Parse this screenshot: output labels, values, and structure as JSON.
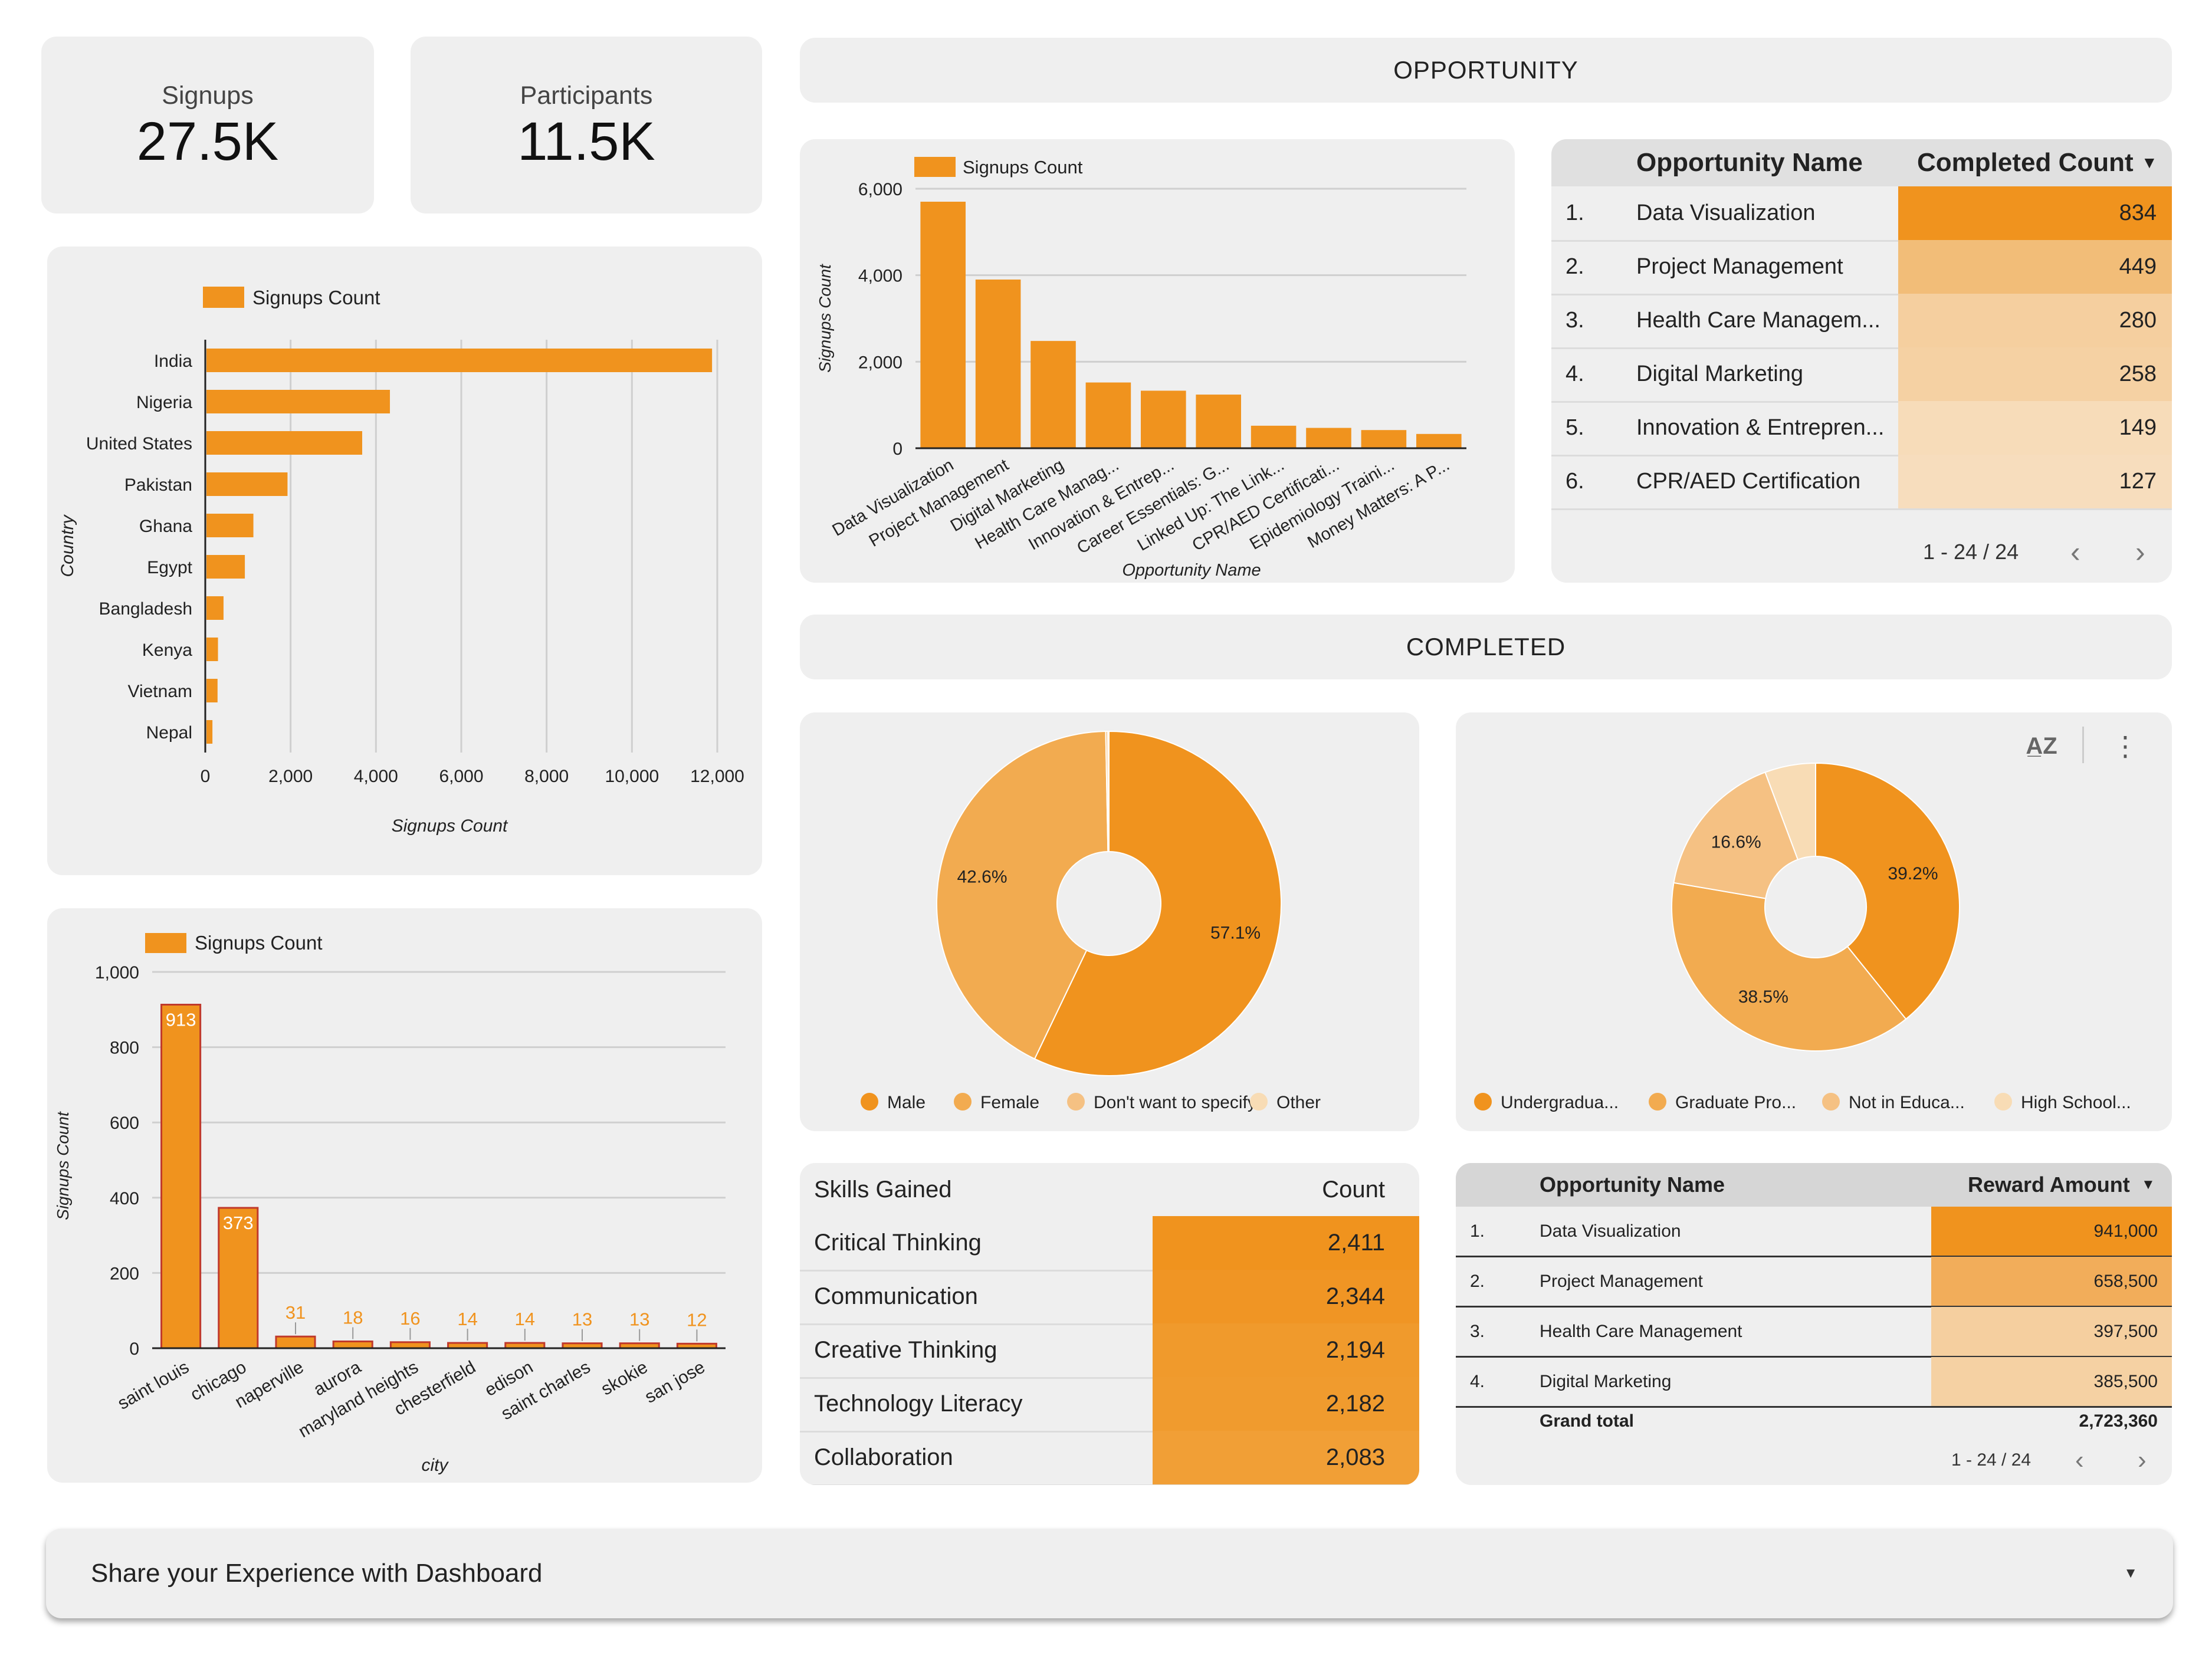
{
  "kpis": {
    "signups": {
      "label": "Signups",
      "value": "27.5K"
    },
    "participants": {
      "label": "Participants",
      "value": "11.5K"
    }
  },
  "sections": {
    "opportunity": "OPPORTUNITY",
    "completed": "COMPLETED"
  },
  "colors": {
    "primary": "#f0931e",
    "light1": "#f2ab50",
    "light2": "#f5c183",
    "light3": "#f8dcb5",
    "bg": "#efefef"
  },
  "chart_data": [
    {
      "id": "country",
      "type": "bar",
      "orientation": "horizontal",
      "legend": "Signups Count",
      "xlabel": "Signups Count",
      "ylabel": "Country",
      "categories": [
        "India",
        "Nigeria",
        "United States",
        "Pakistan",
        "Ghana",
        "Egypt",
        "Bangladesh",
        "Kenya",
        "Vietnam",
        "Nepal"
      ],
      "values": [
        11850,
        4300,
        3650,
        1900,
        1100,
        900,
        400,
        270,
        260,
        140
      ],
      "xlim": [
        0,
        12000
      ],
      "ticks": [
        "0",
        "2,000",
        "4,000",
        "6,000",
        "8,000",
        "10,000",
        "12,000"
      ],
      "color": "#f0931e"
    },
    {
      "id": "city",
      "type": "bar",
      "legend": "Signups Count",
      "xlabel": "city",
      "ylabel": "Signups Count",
      "categories": [
        "saint louis",
        "chicago",
        "naperville",
        "aurora",
        "maryland heights",
        "chesterfield",
        "edison",
        "saint charles",
        "skokie",
        "san jose"
      ],
      "values": [
        913,
        373,
        31,
        18,
        16,
        14,
        14,
        13,
        13,
        12
      ],
      "labels": [
        "913",
        "373",
        "31",
        "18",
        "16",
        "14",
        "14",
        "13",
        "13",
        "12"
      ],
      "ylim": [
        0,
        1000
      ],
      "ticks": [
        "0",
        "200",
        "400",
        "600",
        "800",
        "1,000"
      ],
      "color": "#f0931e"
    },
    {
      "id": "opportunity",
      "type": "bar",
      "legend": "Signups Count",
      "xlabel": "Opportunity Name",
      "ylabel": "Signups Count",
      "categories": [
        "Data Visualization",
        "Project Management",
        "Digital Marketing",
        "Health Care Manag...",
        "Innovation & Entrep...",
        "Career Essentials: G...",
        "Linked Up: The Link...",
        "CPR/AED Certificati...",
        "Epidemiology Traini...",
        "Money Matters: A P..."
      ],
      "values": [
        5700,
        3900,
        2480,
        1520,
        1330,
        1240,
        520,
        470,
        420,
        330
      ],
      "ylim": [
        0,
        6000
      ],
      "ticks": [
        "0",
        "2,000",
        "4,000",
        "6,000"
      ],
      "color": "#f0931e"
    },
    {
      "id": "gender",
      "type": "pie",
      "donut": true,
      "slices": [
        {
          "label": "Male",
          "value": 57.1,
          "text": "57.1%",
          "color": "#f0931e"
        },
        {
          "label": "Female",
          "value": 42.6,
          "text": "42.6%",
          "color": "#f2ab50"
        },
        {
          "label": "Don't want to specify",
          "value": 0.2,
          "text": "",
          "color": "#f5c183"
        },
        {
          "label": "Other",
          "value": 0.1,
          "text": "",
          "color": "#f8dcb5"
        }
      ]
    },
    {
      "id": "education",
      "type": "pie",
      "donut": true,
      "slices": [
        {
          "label": "Undergradua...",
          "value": 39.2,
          "text": "39.2%",
          "color": "#f0931e"
        },
        {
          "label": "Graduate Pro...",
          "value": 38.5,
          "text": "38.5%",
          "color": "#f2ab50"
        },
        {
          "label": "Not in Educa...",
          "value": 16.6,
          "text": "16.6%",
          "color": "#f5c183"
        },
        {
          "label": "High School...",
          "value": 5.7,
          "text": "",
          "color": "#f8dcb5"
        }
      ]
    }
  ],
  "completed_table": {
    "headers": {
      "name": "Opportunity Name",
      "count": "Completed Count"
    },
    "rows": [
      {
        "rank": "1.",
        "name": "Data Visualization",
        "count": "834",
        "n": 834
      },
      {
        "rank": "2.",
        "name": "Project Management",
        "count": "449",
        "n": 449
      },
      {
        "rank": "3.",
        "name": "Health Care Managem...",
        "count": "280",
        "n": 280
      },
      {
        "rank": "4.",
        "name": "Digital Marketing",
        "count": "258",
        "n": 258
      },
      {
        "rank": "5.",
        "name": "Innovation & Entrepren...",
        "count": "149",
        "n": 149
      },
      {
        "rank": "6.",
        "name": "CPR/AED Certification",
        "count": "127",
        "n": 127
      }
    ],
    "pagination": "1 - 24 / 24"
  },
  "skills_table": {
    "headers": {
      "skill": "Skills Gained",
      "count": "Count"
    },
    "rows": [
      {
        "skill": "Critical Thinking",
        "count": "2,411"
      },
      {
        "skill": "Communication",
        "count": "2,344"
      },
      {
        "skill": "Creative Thinking",
        "count": "2,194"
      },
      {
        "skill": "Technology Literacy",
        "count": "2,182"
      },
      {
        "skill": "Collaboration",
        "count": "2,083"
      }
    ]
  },
  "reward_table": {
    "headers": {
      "name": "Opportunity Name",
      "amount": "Reward Amount"
    },
    "rows": [
      {
        "rank": "1.",
        "name": "Data Visualization",
        "amount": "941,000",
        "n": 941000
      },
      {
        "rank": "2.",
        "name": "Project Management",
        "amount": "658,500",
        "n": 658500
      },
      {
        "rank": "3.",
        "name": "Health Care Management",
        "amount": "397,500",
        "n": 397500
      },
      {
        "rank": "4.",
        "name": "Digital Marketing",
        "amount": "385,500",
        "n": 385500
      }
    ],
    "grand_total_label": "Grand total",
    "grand_total": "2,723,360",
    "pagination": "1 - 24 / 24"
  },
  "icons": {
    "sort": "sort-az-icon",
    "more": "more-vert-icon",
    "prev": "chevron-left-icon",
    "next": "chevron-right-icon"
  },
  "share": {
    "label": "Share your Experience with Dashboard"
  }
}
